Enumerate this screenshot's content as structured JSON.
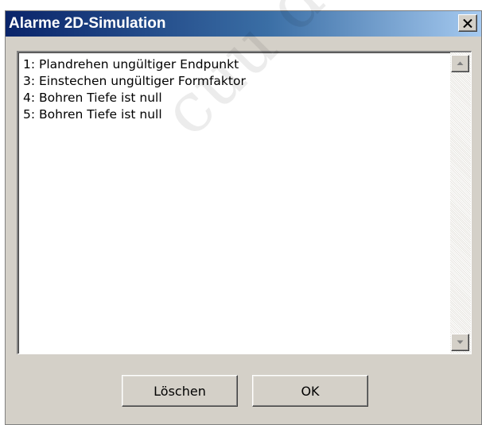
{
  "window": {
    "title": "Alarme 2D-Simulation",
    "close_icon": "close-x-icon"
  },
  "alarms": [
    "1: Plandrehen ungültiger Endpunkt",
    "3: Einstechen ungültiger Formfaktor",
    "4: Bohren Tiefe ist null",
    "5: Bohren Tiefe ist null"
  ],
  "scrollbar": {
    "up_icon": "scroll-up-arrow-icon",
    "down_icon": "scroll-down-arrow-icon"
  },
  "buttons": {
    "delete_label": "Löschen",
    "ok_label": "OK"
  },
  "watermark": "cuu duong",
  "colors": {
    "titlebar_start": "#0a246a",
    "titlebar_end": "#a6caf0",
    "dialog_face": "#d4d0c8"
  }
}
